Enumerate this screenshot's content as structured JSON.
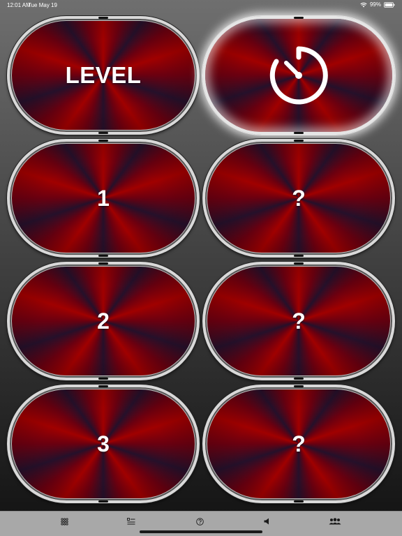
{
  "status_bar": {
    "time": "12:01 AM",
    "date": "Tue May 19",
    "battery": "99%",
    "icons": [
      "wifi-icon",
      "battery-icon"
    ]
  },
  "grid": {
    "header_left": {
      "label": "LEVEL"
    },
    "header_right": {
      "icon": "stopwatch-icon"
    },
    "levels": [
      {
        "label": "1"
      },
      {
        "label": "?"
      },
      {
        "label": "2"
      },
      {
        "label": "?"
      },
      {
        "label": "3"
      },
      {
        "label": "?"
      }
    ]
  },
  "tab_bar": {
    "items": [
      {
        "icon": "grid-icon"
      },
      {
        "icon": "list-icon"
      },
      {
        "icon": "help-icon"
      },
      {
        "icon": "speaker-icon"
      },
      {
        "icon": "people-icon"
      }
    ]
  },
  "colors": {
    "pill_red": "#a00000",
    "pill_dark": "#25102a",
    "pill_border": "#d9d9d9",
    "tab_bar_bg": "#a8a8a8"
  }
}
